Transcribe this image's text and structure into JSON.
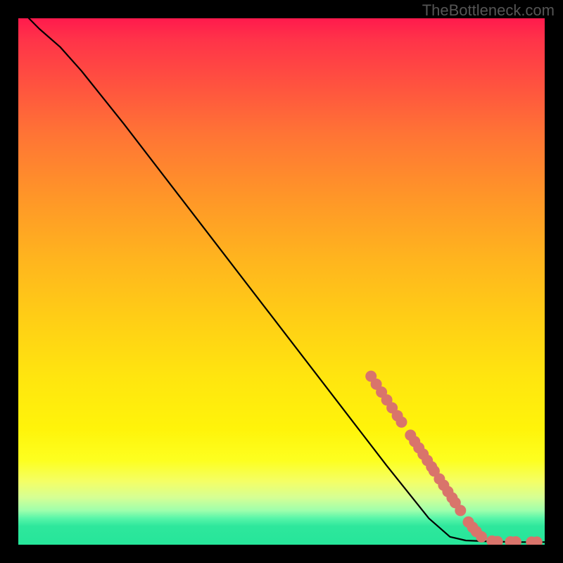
{
  "watermark": "TheBottleneck.com",
  "chart_data": {
    "type": "line",
    "title": "",
    "xlabel": "",
    "ylabel": "",
    "xlim": [
      0,
      100
    ],
    "ylim": [
      0,
      100
    ],
    "curve": [
      {
        "x": 2,
        "y": 100
      },
      {
        "x": 4,
        "y": 98
      },
      {
        "x": 8,
        "y": 94.5
      },
      {
        "x": 12,
        "y": 90
      },
      {
        "x": 20,
        "y": 80
      },
      {
        "x": 30,
        "y": 67
      },
      {
        "x": 40,
        "y": 54
      },
      {
        "x": 50,
        "y": 41
      },
      {
        "x": 60,
        "y": 28
      },
      {
        "x": 70,
        "y": 15
      },
      {
        "x": 78,
        "y": 5
      },
      {
        "x": 82,
        "y": 1.5
      },
      {
        "x": 85,
        "y": 0.8
      },
      {
        "x": 90,
        "y": 0.6
      },
      {
        "x": 95,
        "y": 0.5
      },
      {
        "x": 100,
        "y": 0.5
      }
    ],
    "markers": [
      {
        "x": 67,
        "y": 32
      },
      {
        "x": 68,
        "y": 30.5
      },
      {
        "x": 69,
        "y": 29
      },
      {
        "x": 70,
        "y": 27.5
      },
      {
        "x": 71,
        "y": 26
      },
      {
        "x": 72,
        "y": 24.5
      },
      {
        "x": 72.8,
        "y": 23.3
      },
      {
        "x": 74.5,
        "y": 20.8
      },
      {
        "x": 75.3,
        "y": 19.6
      },
      {
        "x": 76.1,
        "y": 18.4
      },
      {
        "x": 76.9,
        "y": 17.2
      },
      {
        "x": 77.7,
        "y": 16
      },
      {
        "x": 78.5,
        "y": 14.8
      },
      {
        "x": 79,
        "y": 14
      },
      {
        "x": 80,
        "y": 12.5
      },
      {
        "x": 80.8,
        "y": 11.3
      },
      {
        "x": 81.6,
        "y": 10.1
      },
      {
        "x": 82.4,
        "y": 8.9
      },
      {
        "x": 83,
        "y": 8
      },
      {
        "x": 84,
        "y": 6.5
      },
      {
        "x": 85.5,
        "y": 4.3
      },
      {
        "x": 86.3,
        "y": 3.3
      },
      {
        "x": 87,
        "y": 2.5
      },
      {
        "x": 88,
        "y": 1.5
      },
      {
        "x": 90,
        "y": 0.7
      },
      {
        "x": 91,
        "y": 0.6
      },
      {
        "x": 93.5,
        "y": 0.55
      },
      {
        "x": 94.5,
        "y": 0.55
      },
      {
        "x": 97.5,
        "y": 0.5
      },
      {
        "x": 98.5,
        "y": 0.5
      }
    ],
    "marker_color": "#d9746b",
    "marker_radius": 8
  }
}
